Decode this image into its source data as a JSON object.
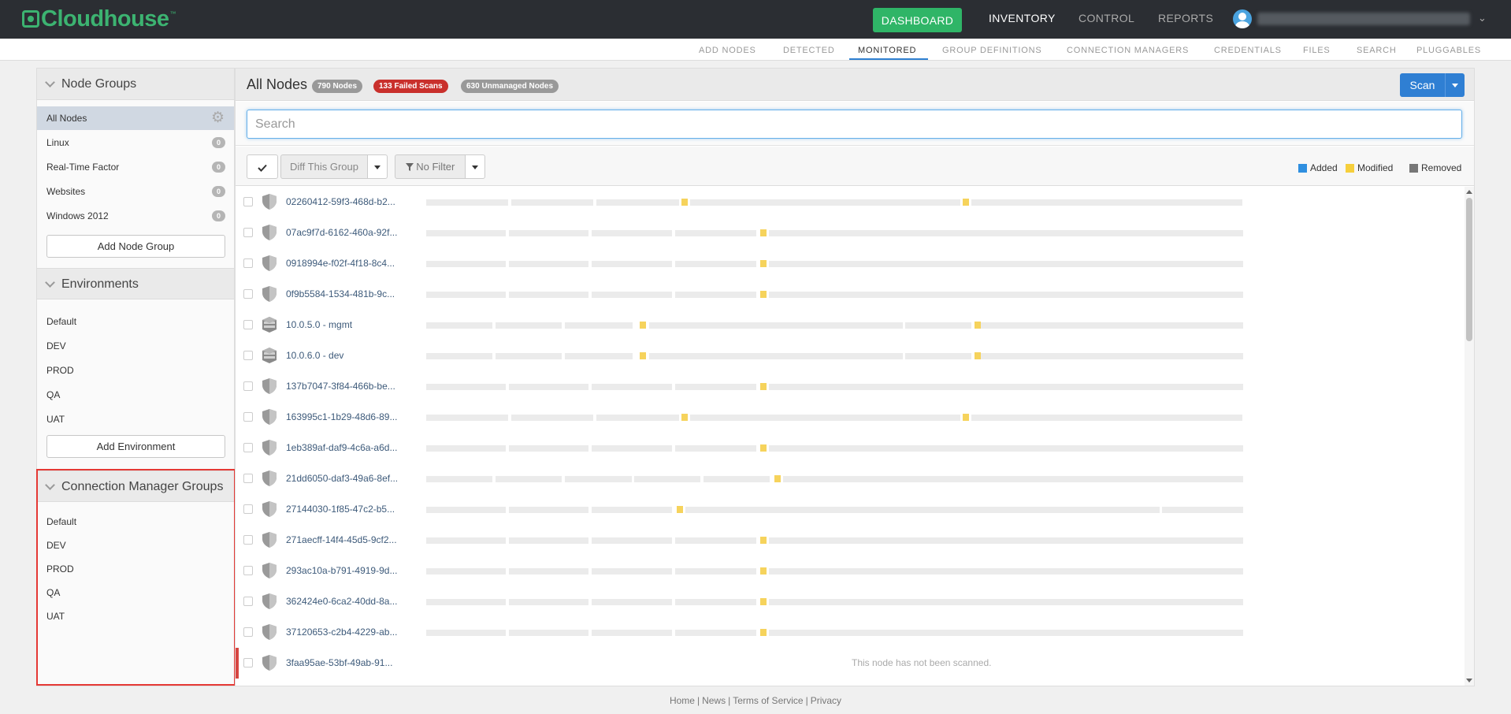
{
  "app": {
    "logo_text": "Cloudhouse",
    "logo_tm": "™"
  },
  "topnav": {
    "dashboard": "DASHBOARD",
    "inventory": "INVENTORY",
    "control": "CONTROL",
    "reports": "REPORTS"
  },
  "subnav": [
    "ADD NODES",
    "DETECTED",
    "MONITORED",
    "GROUP DEFINITIONS",
    "CONNECTION MANAGERS",
    "CREDENTIALS",
    "FILES",
    "SEARCH",
    "PLUGGABLES"
  ],
  "subnav_active": "MONITORED",
  "sidebar": {
    "node_groups": {
      "title": "Node Groups",
      "items": [
        {
          "label": "All Nodes",
          "selected": true
        },
        {
          "label": "Linux",
          "badge": "0"
        },
        {
          "label": "Real-Time Factor",
          "badge": "0"
        },
        {
          "label": "Websites",
          "badge": "0"
        },
        {
          "label": "Windows 2012",
          "badge": "0"
        }
      ],
      "add_button": "Add Node Group"
    },
    "environments": {
      "title": "Environments",
      "items": [
        "Default",
        "DEV",
        "PROD",
        "QA",
        "UAT"
      ],
      "add_button": "Add Environment"
    },
    "connection_manager_groups": {
      "title": "Connection Manager Groups",
      "items": [
        "Default",
        "DEV",
        "PROD",
        "QA",
        "UAT"
      ]
    }
  },
  "main": {
    "title": "All Nodes",
    "badges": {
      "nodes": "790 Nodes",
      "failed": "133 Failed Scans",
      "unmanaged": "630 Unmanaged Nodes"
    },
    "scan_button": "Scan",
    "search_placeholder": "Search",
    "toolbar": {
      "diff": "Diff This Group",
      "filter": "No Filter"
    },
    "legend": [
      {
        "label": "Added",
        "color": "#2f8fe0"
      },
      {
        "label": "Modified",
        "color": "#f6cf3c"
      },
      {
        "label": "Removed",
        "color": "#777777"
      }
    ],
    "rows": [
      {
        "name": "02260412-59f3-468d-b2...",
        "icon": "shield-icon",
        "pattern": "a"
      },
      {
        "name": "07ac9f7d-6162-460a-92f...",
        "icon": "shield-icon",
        "pattern": "b"
      },
      {
        "name": "0918994e-f02f-4f18-8c4...",
        "icon": "shield-icon",
        "pattern": "b"
      },
      {
        "name": "0f9b5584-1534-481b-9c...",
        "icon": "shield-icon",
        "pattern": "b"
      },
      {
        "name": "10.0.5.0 - mgmt",
        "icon": "cube-icon",
        "pattern": "c"
      },
      {
        "name": "10.0.6.0 - dev",
        "icon": "cube-icon",
        "pattern": "c"
      },
      {
        "name": "137b7047-3f84-466b-be...",
        "icon": "shield-icon",
        "pattern": "b"
      },
      {
        "name": "163995c1-1b29-48d6-89...",
        "icon": "shield-icon",
        "pattern": "a"
      },
      {
        "name": "1eb389af-daf9-4c6a-a6d...",
        "icon": "shield-icon",
        "pattern": "b"
      },
      {
        "name": "21dd6050-daf3-49a6-8ef...",
        "icon": "shield-icon",
        "pattern": "d"
      },
      {
        "name": "27144030-1f85-47c2-b5...",
        "icon": "shield-icon",
        "pattern": "e"
      },
      {
        "name": "271aecff-14f4-45d5-9cf2...",
        "icon": "shield-icon",
        "pattern": "b"
      },
      {
        "name": "293ac10a-b791-4919-9d...",
        "icon": "shield-icon",
        "pattern": "b"
      },
      {
        "name": "362424e0-6ca2-40dd-8a...",
        "icon": "shield-icon",
        "pattern": "b"
      },
      {
        "name": "37120653-c2b4-4229-ab...",
        "icon": "shield-icon",
        "pattern": "b"
      },
      {
        "name": "3faa95ae-53bf-49ab-91...",
        "icon": "shield-icon",
        "pattern": "none",
        "message": "This node has not been scanned.",
        "flag": true
      }
    ]
  },
  "footer": {
    "links": [
      "Home",
      "News",
      "Terms of Service",
      "Privacy"
    ],
    "separator": "|"
  }
}
